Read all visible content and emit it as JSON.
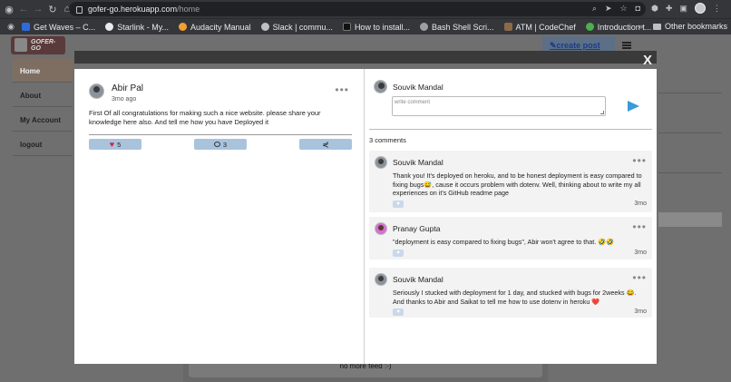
{
  "browser": {
    "url_host": "gofer-go.herokuapp.com",
    "url_path": "/home",
    "bookmarks": [
      {
        "label": "Get Waves – C...",
        "color": "#2f6bd8"
      },
      {
        "label": "Starlink - My...",
        "color": "#e8eaed"
      },
      {
        "label": "Audacity Manual",
        "color": "#f0a030"
      },
      {
        "label": "Slack | commu...",
        "color": "#bdc1c6"
      },
      {
        "label": "How to install...",
        "color": "#111111"
      },
      {
        "label": "Bash Shell Scri...",
        "color": "#9aa0a6"
      },
      {
        "label": "ATM | CodeChef",
        "color": "#8a6a4a"
      },
      {
        "label": "Introduction t...",
        "color": "#4caf50"
      }
    ],
    "more_label": "»",
    "other_bookmarks": "Other bookmarks"
  },
  "app": {
    "logo_text": "GOFER-GO",
    "create_post": "create post",
    "nav": [
      "Home",
      "About",
      "My Account",
      "logout"
    ],
    "feed_end": "no more feed :-)"
  },
  "modal": {
    "close": "X",
    "post": {
      "author": "Abir Pal",
      "time": "3mo ago",
      "body": "First Of all congratulations for making such a nice website. please share your knowledge here also. And tell me how you have Deployed it",
      "likes": "5",
      "comments": "3"
    },
    "composer": {
      "author": "Souvik Mandal",
      "placeholder": "write comment"
    },
    "comment_count": "3 comments",
    "comments": [
      {
        "author": "Souvik Mandal",
        "text": "Thank you! It's deployed on heroku, and to be honest deployment is easy compared to fixing bugs😅, cause it occurs problem with dotenv. Well, thinking about to write my all experiences on it's GitHub readme page",
        "time": "3mo"
      },
      {
        "author": "Pranay Gupta",
        "text": "\"deployment is easy compared to fixing bugs\", Abir won't agree to that. 🤣🤣",
        "time": "3mo"
      },
      {
        "author": "Souvik Mandal",
        "text": "Seriously I stucked with deployment for 1 day, and stucked with bugs for 2weeks 😂. And thanks to Abir and Saikat to tell me how to use dotenv in heroku ❤️",
        "time": "3mo"
      }
    ]
  }
}
